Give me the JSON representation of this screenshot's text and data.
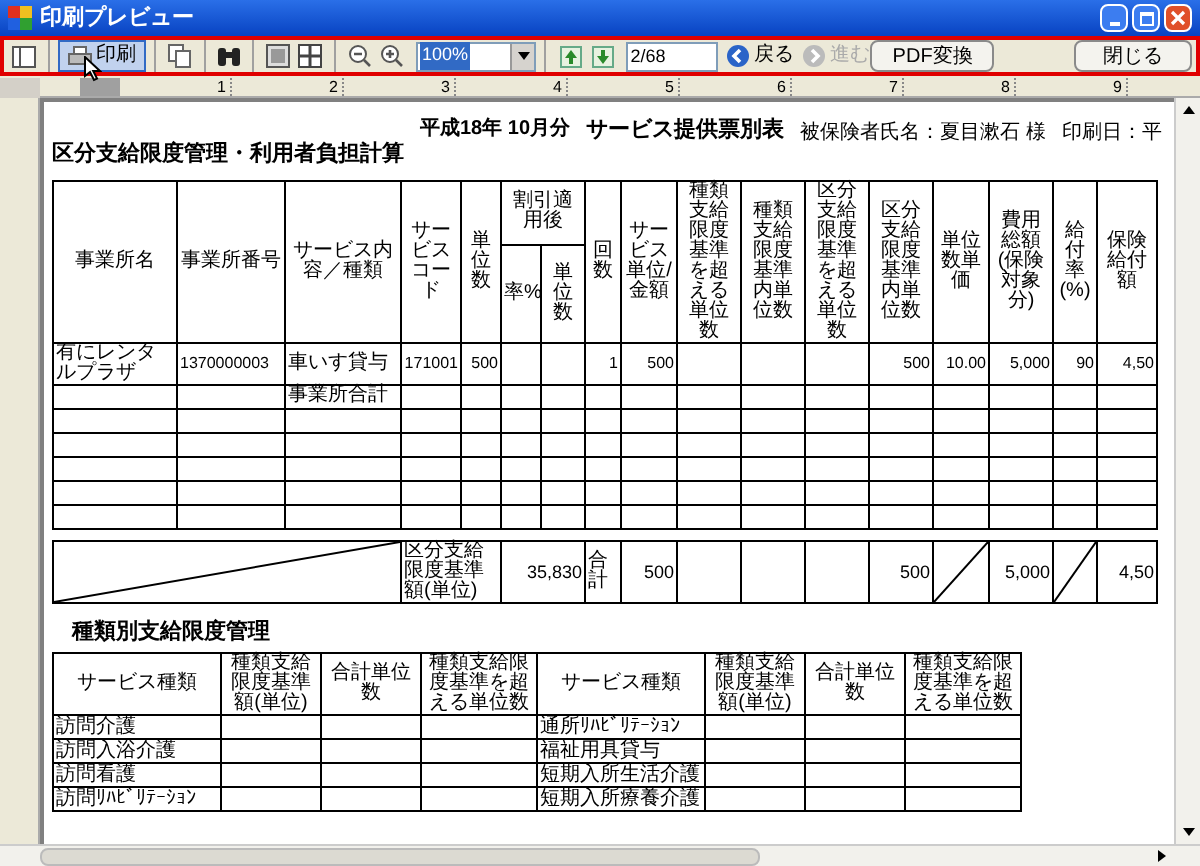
{
  "window": {
    "title": "印刷プレビュー"
  },
  "toolbar": {
    "print_button": {
      "label": "印刷",
      "selected": true
    },
    "zoom_select": {
      "value": "100%"
    },
    "page_field": {
      "value": "2/68"
    },
    "back_button": {
      "label": "戻る",
      "disabled": false
    },
    "forward_button": {
      "label": "進む",
      "disabled": true
    },
    "pdf_button": {
      "label": "PDF変換"
    },
    "close_button": {
      "label": "閉じる"
    }
  },
  "ruler": {
    "labels": [
      "1",
      "2",
      "3",
      "4",
      "5",
      "6",
      "7",
      "8",
      "9"
    ]
  },
  "document": {
    "title": "区分支給限度管理・利用者負担計算",
    "period": "平成18年 10月分",
    "report_title": "サービス提供票別表",
    "insured": "被保険者氏名：夏目漱石 様",
    "print_date": "印刷日：平",
    "columns": [
      {
        "label": "事業所名"
      },
      {
        "label": "事業所番号"
      },
      {
        "label": "サービス内容／種類"
      },
      {
        "label": "サービスコード"
      },
      {
        "label": "単位数"
      },
      {
        "label": "率%",
        "group": {
          "label": "割引適用後"
        }
      },
      {
        "label": "単位数"
      },
      {
        "label": "回数"
      },
      {
        "label": "サービス単位/金額"
      },
      {
        "label": "種類支給限度基準を超える単位数"
      },
      {
        "label": "種類支給限度基準内単位数"
      },
      {
        "label": "区分支給限度基準を超える単位数"
      },
      {
        "label": "区分支給限度基準内単位数"
      },
      {
        "label": "単位数単価"
      },
      {
        "label": "費用総額(保険対象分)"
      },
      {
        "label": "給付率(%)"
      },
      {
        "label": "保険給付額"
      }
    ],
    "rows": [
      [
        "有にレンタルプラザ",
        "1370000003",
        "車いす貸与",
        "171001",
        "500",
        null,
        null,
        "1",
        "500",
        null,
        null,
        null,
        "500",
        "10.00",
        "5,000",
        "90",
        "4,50"
      ],
      [
        null,
        null,
        "事業所合計",
        null,
        null,
        null,
        null,
        null,
        null,
        null,
        null,
        null,
        null,
        null,
        null,
        null,
        null
      ]
    ],
    "totals": {
      "limit_label": "区分支給限度基準額(単位)",
      "limit": "35,830",
      "total_label": "合計",
      "service_units": "500",
      "within_units": "500",
      "cost_total": "5,000",
      "benefit": "4,50"
    },
    "kind_section": {
      "title": "種類別支給限度管理",
      "columns": [
        "サービス種類",
        "種類支給限度基準額(単位)",
        "合計単位数",
        "種類支給限度基準を超える単位数",
        "サービス種類",
        "種類支給限度基準額(単位)",
        "合計単位数",
        "種類支給限度基準を超える単位数"
      ],
      "rows": [
        {
          "left": "訪問介護",
          "right": "通所ﾘﾊﾋﾞﾘﾃｰｼｮﾝ"
        },
        {
          "left": "訪問入浴介護",
          "right": "福祉用具貸与"
        },
        {
          "left": "訪問看護",
          "right": "短期入所生活介護"
        },
        {
          "left": "訪問ﾘﾊﾋﾞﾘﾃｰｼｮﾝ",
          "right": "短期入所療養介護"
        }
      ]
    }
  }
}
